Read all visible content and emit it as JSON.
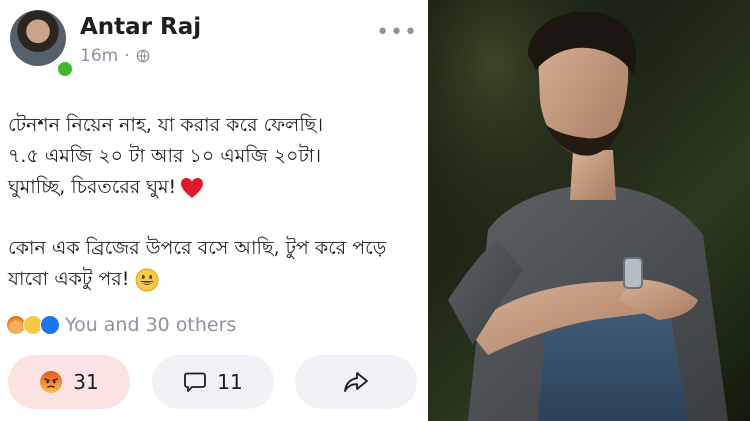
{
  "post": {
    "author": "Antar Raj",
    "time": "16m",
    "time_separator": "·",
    "more": "•••",
    "lines": {
      "l1": "টেনশন নিয়েন নাহ, যা করার করে ফেলছি।",
      "l2": "৭.৫ এমজি ২০ টা আর ১০ এমজি ২০টা।",
      "l3": "ঘুমাচ্ছি, চিরতরের ঘুম!",
      "l4": "কোন এক ব্রিজের উপরে বসে আছি, টুপ করে পড়ে",
      "l5": "যাবো একটু পর!"
    },
    "reactions": {
      "icons": [
        "angry-icon",
        "sad-icon",
        "like-icon"
      ],
      "summary": "You and 30 others"
    },
    "actions": {
      "react_count": "31",
      "comment_count": "11"
    }
  },
  "colors": {
    "name": "#1c1e21",
    "meta": "#8d949e",
    "online": "#42b72a",
    "reacted_button_bg": "#fbe3e3",
    "button_bg": "#f0f2f5"
  }
}
